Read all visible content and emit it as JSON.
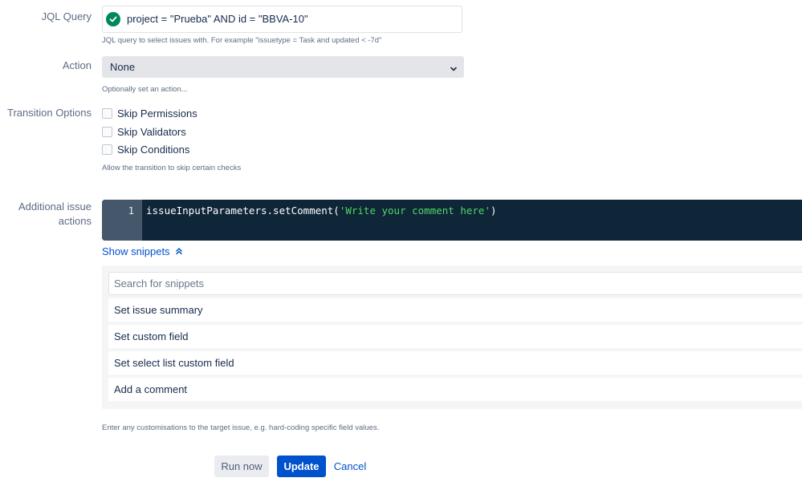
{
  "jql": {
    "label": "JQL Query",
    "value": "project = \"Prueba\" AND id = \"BBVA-10\"",
    "status_icon": "check-circle-icon",
    "hint": "JQL query to select issues with. For example \"issuetype = Task and updated < -7d\""
  },
  "action": {
    "label": "Action",
    "selected": "None",
    "hint": "Optionally set an action..."
  },
  "transition": {
    "label": "Transition Options",
    "options": [
      {
        "label": "Skip Permissions",
        "checked": false
      },
      {
        "label": "Skip Validators",
        "checked": false
      },
      {
        "label": "Skip Conditions",
        "checked": false
      }
    ],
    "hint": "Allow the transition to skip certain checks"
  },
  "additional": {
    "label_line1": "Additional issue",
    "label_line2": "actions",
    "editor": {
      "line_number": "1",
      "code_prefix": "issueInputParameters.setComment(",
      "code_string": "'Write your comment here'",
      "code_suffix": ")"
    },
    "show_snippets": "Show snippets",
    "snippet_search_placeholder": "Search for snippets",
    "snippets": [
      "Set issue summary",
      "Set custom field",
      "Set select list custom field",
      "Add a comment"
    ],
    "hint": "Enter any customisations to the target issue, e.g. hard-coding specific field values."
  },
  "buttons": {
    "run_now": "Run now",
    "update": "Update",
    "cancel": "Cancel"
  },
  "colors": {
    "primary": "#0052cc",
    "success": "#00875a",
    "editor_bg": "#0f2538",
    "string": "#4cd964"
  }
}
